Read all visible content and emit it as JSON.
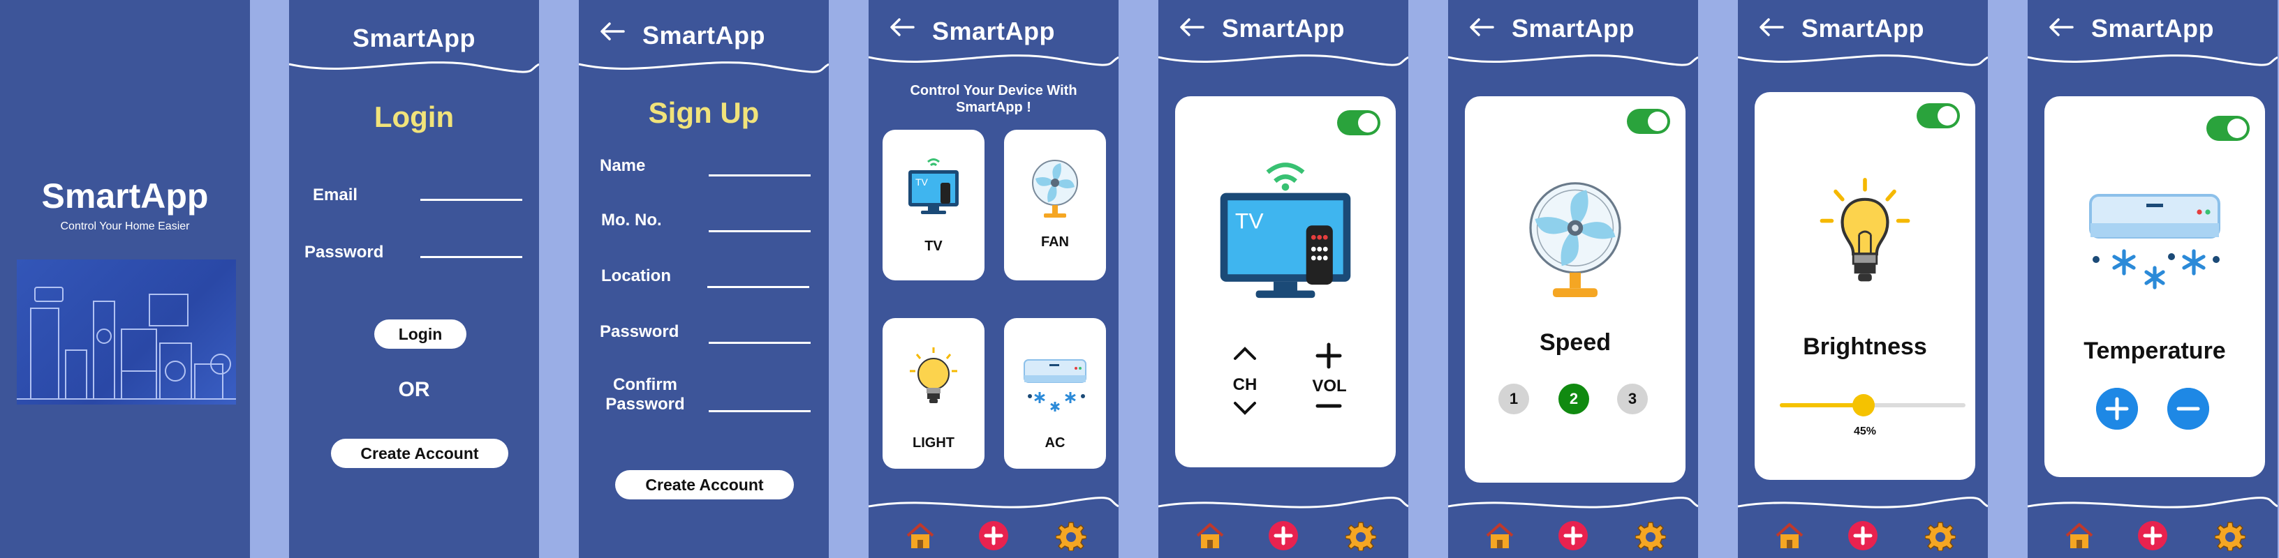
{
  "app": {
    "name": "SmartApp"
  },
  "splash": {
    "title": "SmartApp",
    "subtitle": "Control Your Home Easier"
  },
  "login": {
    "heading": "Login",
    "email_label": "Email",
    "password_label": "Password",
    "login_button": "Login",
    "or_text": "OR",
    "create_account_button": "Create Account"
  },
  "signup": {
    "heading": "Sign Up",
    "fields": [
      "Name",
      "Mo. No.",
      "Location",
      "Password",
      "Confirm\nPassword"
    ],
    "create_account_button": "Create Account"
  },
  "devices": {
    "heading": "Control Your Device With SmartApp !",
    "items": [
      {
        "label": "TV",
        "icon": "tv-icon"
      },
      {
        "label": "FAN",
        "icon": "fan-icon"
      },
      {
        "label": "LIGHT",
        "icon": "bulb-icon"
      },
      {
        "label": "AC",
        "icon": "ac-icon"
      }
    ]
  },
  "tv": {
    "ch_label": "CH",
    "vol_label": "VOL",
    "power_on": true
  },
  "fan": {
    "title": "Speed",
    "speeds": [
      "1",
      "2",
      "3"
    ],
    "selected_speed": "2",
    "power_on": true
  },
  "light": {
    "title": "Brightness",
    "brightness_percent": 45,
    "brightness_label": "45%",
    "power_on": true
  },
  "ac": {
    "title": "Temperature",
    "power_on": true
  },
  "footer": {
    "home_icon": "home-icon",
    "add_icon": "add-icon",
    "settings_icon": "gear-icon"
  },
  "colors": {
    "background": "#3d5599",
    "page_bg": "#9aaee6",
    "heading_yellow": "#f1e37a",
    "toggle_green": "#2aa33c",
    "accent_red": "#e8224f",
    "active_green": "#108a10",
    "accent_blue": "#1e88e5",
    "slider_yellow": "#f5c200"
  }
}
